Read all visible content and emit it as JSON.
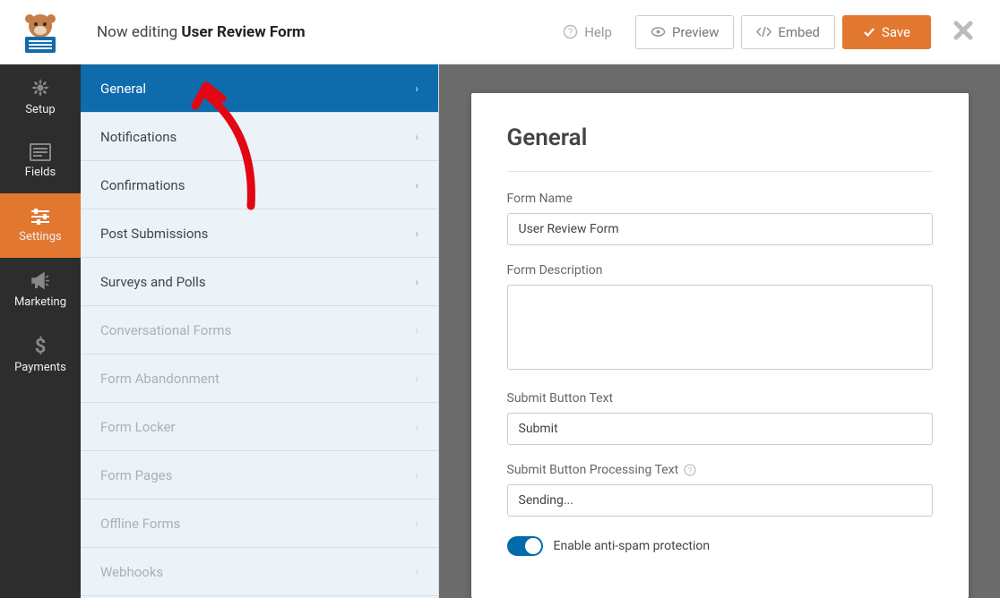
{
  "header": {
    "editing_prefix": "Now editing",
    "form_title": "User Review Form",
    "help_label": "Help",
    "preview_label": "Preview",
    "embed_label": "Embed",
    "save_label": "Save"
  },
  "sidenav": {
    "setup": "Setup",
    "fields": "Fields",
    "settings": "Settings",
    "marketing": "Marketing",
    "payments": "Payments"
  },
  "subpanel": {
    "items": [
      {
        "label": "General",
        "active": true,
        "disabled": false
      },
      {
        "label": "Notifications",
        "active": false,
        "disabled": false
      },
      {
        "label": "Confirmations",
        "active": false,
        "disabled": false
      },
      {
        "label": "Post Submissions",
        "active": false,
        "disabled": false
      },
      {
        "label": "Surveys and Polls",
        "active": false,
        "disabled": false
      },
      {
        "label": "Conversational Forms",
        "active": false,
        "disabled": true
      },
      {
        "label": "Form Abandonment",
        "active": false,
        "disabled": true
      },
      {
        "label": "Form Locker",
        "active": false,
        "disabled": true
      },
      {
        "label": "Form Pages",
        "active": false,
        "disabled": true
      },
      {
        "label": "Offline Forms",
        "active": false,
        "disabled": true
      },
      {
        "label": "Webhooks",
        "active": false,
        "disabled": true
      }
    ]
  },
  "page": {
    "heading": "General",
    "form_name_label": "Form Name",
    "form_name_value": "User Review Form",
    "form_description_label": "Form Description",
    "form_description_value": "",
    "submit_button_text_label": "Submit Button Text",
    "submit_button_text_value": "Submit",
    "submit_processing_label": "Submit Button Processing Text",
    "submit_processing_value": "Sending...",
    "antispam_label": "Enable anti-spam protection",
    "antispam_enabled": true
  }
}
